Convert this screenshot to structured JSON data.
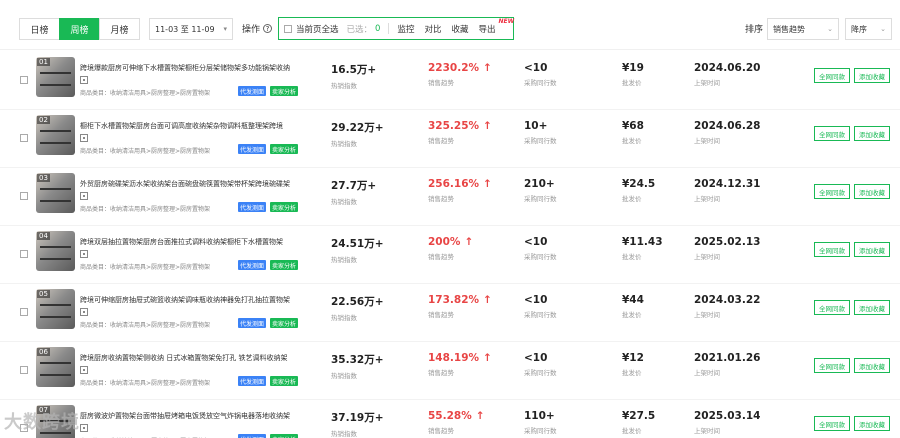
{
  "toolbar": {
    "period_tabs": [
      {
        "label": "日榜",
        "active": false
      },
      {
        "label": "周榜",
        "active": true
      },
      {
        "label": "月榜",
        "active": false
      }
    ],
    "date_range": "11-03 至 11-09",
    "ops_label": "操作",
    "select_all_label": "当前页全选",
    "selected_label": "已选：",
    "selected_count": "0",
    "actions": [
      "监控",
      "对比",
      "收藏"
    ],
    "export_label": "导出",
    "new_badge": "NEW",
    "sort_label": "排序",
    "sort_value": "销售趋势",
    "order_value": "降序"
  },
  "labels": {
    "hot_index": "热销指数",
    "sales_trend": "销售趋势",
    "peer_count": "采购同行数",
    "wholesale_price": "批发价",
    "listed_time": "上架时间",
    "badge_daifa": "代发测面",
    "badge_maijia": "卖家分析",
    "btn_same": "全网同款",
    "btn_fav": "添加收藏"
  },
  "products": [
    {
      "rank": "01",
      "title": "跨境爆款厨房可伸缩下水槽置物架橱柜分层架储物架多功能锅架收纳",
      "category": "商品类目：收纳清洁用具>厨房整理>厨房置物架",
      "hot_index": "16.5万+",
      "trend": "2230.2%",
      "peer": "<10",
      "price": "¥19",
      "date": "2024.06.20"
    },
    {
      "rank": "02",
      "title": "橱柜下水槽置物架厨房台面可调高度收纳架杂物调料瓶整理架跨境",
      "category": "商品类目：收纳清洁用具>厨房整理>厨房置物架",
      "hot_index": "29.22万+",
      "trend": "325.25%",
      "peer": "10+",
      "price": "¥68",
      "date": "2024.06.28"
    },
    {
      "rank": "03",
      "title": "外贸厨房碗碟架沥水架收纳架台面碗盘碗筷置物架带杯架跨境碗碟架",
      "category": "商品类目：收纳清洁用具>厨房整理>厨房置物架",
      "hot_index": "27.7万+",
      "trend": "256.16%",
      "peer": "210+",
      "price": "¥24.5",
      "date": "2024.12.31"
    },
    {
      "rank": "04",
      "title": "跨境双层抽拉置物架厨房台面推拉式调料收纳架橱柜下水槽置物架",
      "category": "商品类目：收纳清洁用具>厨房整理>厨房置物架",
      "hot_index": "24.51万+",
      "trend": "200%",
      "peer": "<10",
      "price": "¥11.43",
      "date": "2025.02.13"
    },
    {
      "rank": "05",
      "title": "跨境可伸缩厨房抽屉式碗篮收纳架调味瓶收纳神器免打孔抽拉置物架",
      "category": "商品类目：收纳清洁用具>厨房整理>厨房置物架",
      "hot_index": "22.56万+",
      "trend": "173.82%",
      "peer": "<10",
      "price": "¥44",
      "date": "2024.03.22"
    },
    {
      "rank": "06",
      "title": "跨境厨房收纳置物架侧收纳 日式冰箱置物架免打孔 铁艺调料收纳架",
      "category": "商品类目：收纳清洁用具>厨房整理>厨房置物架",
      "hot_index": "35.32万+",
      "trend": "148.19%",
      "peer": "<10",
      "price": "¥12",
      "date": "2021.01.26"
    },
    {
      "rank": "07",
      "title": "厨房微波炉置物架台面带抽屉烤箱电饭煲放空气炸锅电器落地收纳架",
      "category": "商品类目：收纳清洁用具>厨房整理>厨房置物架",
      "hot_index": "37.19万+",
      "trend": "55.28%",
      "peer": "110+",
      "price": "¥27.5",
      "date": "2025.03.14"
    }
  ],
  "watermark": "大数跨境",
  "colors": {
    "accent": "#19b955",
    "trend_red": "#e84545",
    "badge_blue": "#3b82f6"
  },
  "icons": [
    "help-icon",
    "checkbox-icon",
    "chevron-down-icon",
    "grid-icon",
    "up-arrow-icon"
  ]
}
